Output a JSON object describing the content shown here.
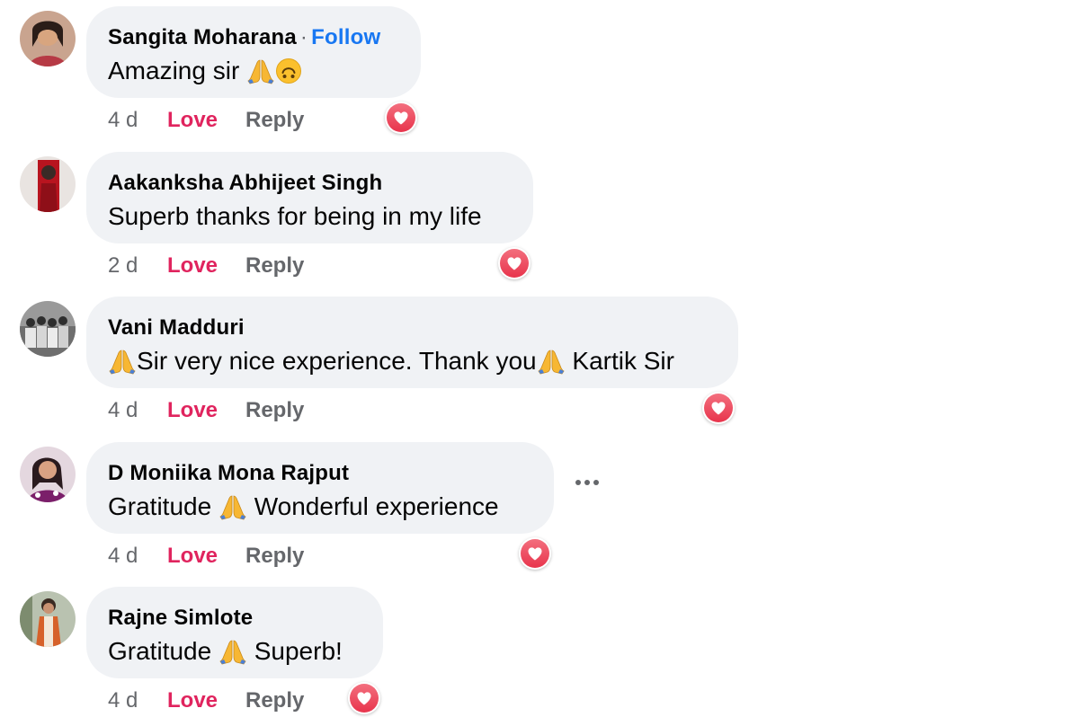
{
  "comments": [
    {
      "author": "Sangita Moharana",
      "follow_label": "Follow",
      "text_before": "Amazing sir ",
      "time": "4 d",
      "love_label": "Love",
      "reply_label": "Reply",
      "reaction": "heart-icon"
    },
    {
      "author": "Aakanksha Abhijeet Singh",
      "text": "Superb thanks for being in my life",
      "time": "2 d",
      "love_label": "Love",
      "reply_label": "Reply",
      "reaction": "heart-icon"
    },
    {
      "author": "Vani Madduri",
      "text_part1": "Sir very nice experience. Thank you",
      "text_part2": " Kartik Sir",
      "time": "4 d",
      "love_label": "Love",
      "reply_label": "Reply",
      "reaction": "heart-icon"
    },
    {
      "author": "D Moniika Mona Rajput",
      "text_part1": "Gratitude ",
      "text_part2": " Wonderful experience",
      "time": "4 d",
      "love_label": "Love",
      "reply_label": "Reply",
      "reaction": "heart-icon",
      "more_icon": "more-options-icon"
    },
    {
      "author": "Rajne Simlote",
      "text_part1": "Gratitude ",
      "text_part2": " Superb!",
      "time": "4 d",
      "love_label": "Love",
      "reply_label": "Reply",
      "reaction": "heart-icon"
    }
  ],
  "colors": {
    "bubble": "#f0f2f5",
    "love": "#e0245e",
    "follow": "#1877f2",
    "muted": "#65676b"
  }
}
